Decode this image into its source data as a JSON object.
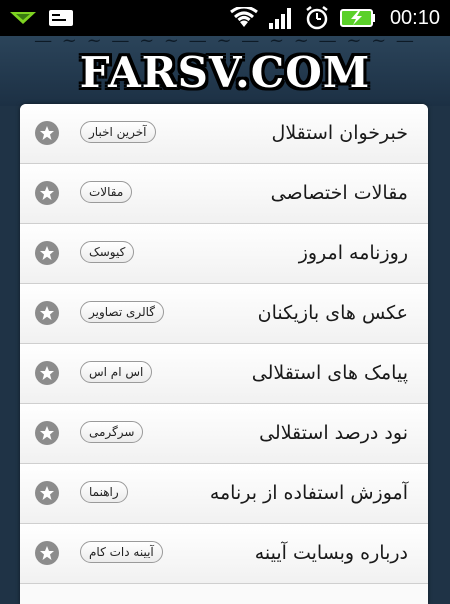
{
  "status_bar": {
    "time": "00:10",
    "icons": [
      "notification-arrow-icon",
      "sms-icon",
      "wifi-icon",
      "signal-icon",
      "alarm-icon",
      "battery-charging-icon"
    ]
  },
  "header": {
    "watermark": "FARSV.COM"
  },
  "menu": {
    "items": [
      {
        "title": "خبرخوان استقلال",
        "tag": "آخرین اخبار"
      },
      {
        "title": "مقالات اختصاصی",
        "tag": "مقالات"
      },
      {
        "title": "روزنامه امروز",
        "tag": "کیوسک"
      },
      {
        "title": "عکس های بازیکنان",
        "tag": "گالری تصاویر"
      },
      {
        "title": "پیامک های استقلالی",
        "tag": "اس ام اس"
      },
      {
        "title": "نود درصد استقلالی",
        "tag": "سرگرمی"
      },
      {
        "title": "آموزش استفاده از برنامه",
        "tag": "راهنما"
      },
      {
        "title": "درباره وبسایت آیینه",
        "tag": "آیینه دات کام"
      }
    ]
  },
  "colors": {
    "header_bg": "#1f3346",
    "status_bar_bg": "#000000",
    "battery_green": "#5bd02a",
    "notification_green": "#7ed321",
    "star_badge": "#8c8c8c"
  }
}
